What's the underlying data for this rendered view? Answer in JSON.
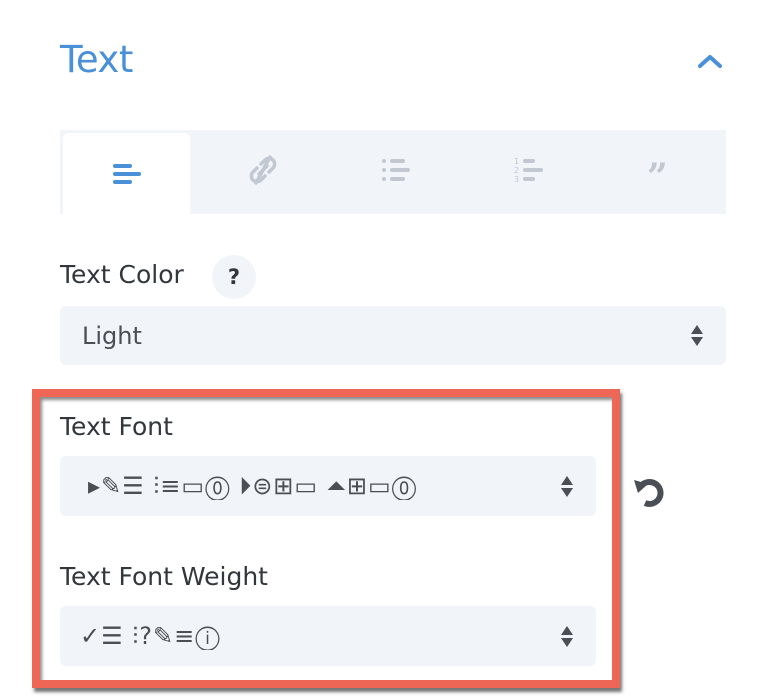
{
  "section": {
    "title": "Text",
    "collapse_icon": "chevron-up-icon"
  },
  "tabs": [
    {
      "name": "text",
      "icon": "align-left-icon",
      "active": true
    },
    {
      "name": "link",
      "icon": "link-icon",
      "active": false
    },
    {
      "name": "unordered-list",
      "icon": "bullet-list-icon",
      "active": false
    },
    {
      "name": "ordered-list",
      "icon": "numbered-list-icon",
      "active": false
    },
    {
      "name": "quote",
      "icon": "quote-icon",
      "active": false
    }
  ],
  "fields": {
    "text_color": {
      "label": "Text Color",
      "help": "?",
      "value": "Light"
    },
    "text_font": {
      "label": "Text Font",
      "value": "▸✎☰ ⫶≡▭⓪ ⏵⊜⊞▭ ⏶⊞▭⓪"
    },
    "text_font_weight": {
      "label": "Text Font Weight",
      "value": "✓☰ ⫶?✎≡ⓘ"
    }
  },
  "colors": {
    "accent": "#4a90d9",
    "highlight": "#ee6656",
    "input_bg": "#f1f4f9",
    "text": "#32373c"
  }
}
